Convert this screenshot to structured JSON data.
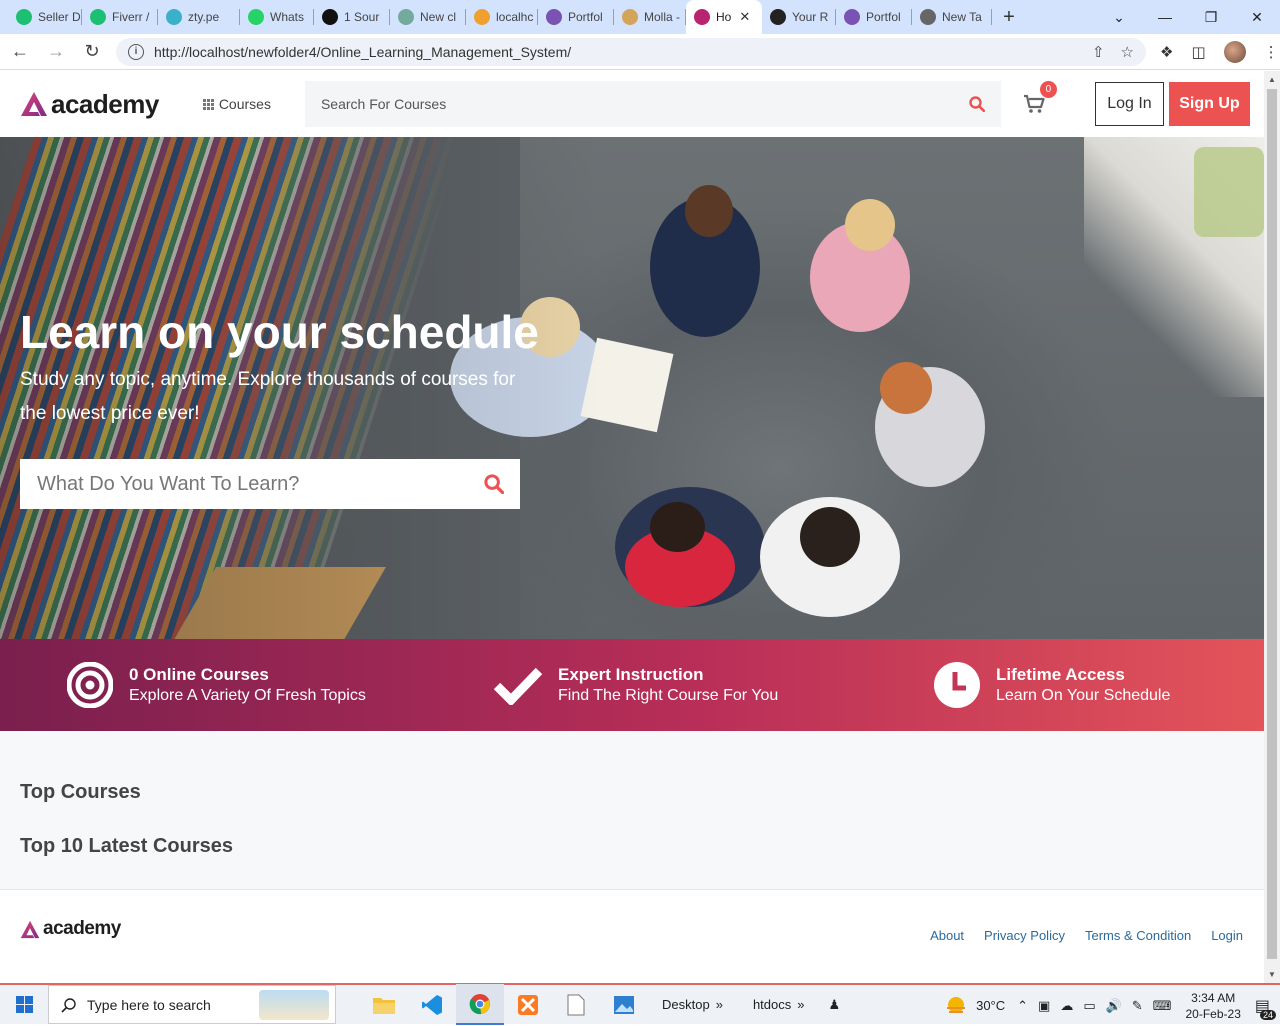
{
  "browser": {
    "tabs": [
      {
        "title": "Seller D",
        "icon": "fiverr-icon",
        "color": "#1dbf73"
      },
      {
        "title": "Fiverr /",
        "icon": "fiverr-icon",
        "color": "#1dbf73"
      },
      {
        "title": "zty.pe",
        "icon": "ztype-icon",
        "color": "#3bb0c9"
      },
      {
        "title": "Whats",
        "icon": "whatsapp-icon",
        "color": "#25d366"
      },
      {
        "title": "1 Sour",
        "icon": "eye-icon",
        "color": "#111111"
      },
      {
        "title": "New cl",
        "icon": "chatgpt-icon",
        "color": "#74aa9c"
      },
      {
        "title": "localhc",
        "icon": "phpmyadmin-icon",
        "color": "#f0a030"
      },
      {
        "title": "Portfol",
        "icon": "bootstrap-icon",
        "color": "#7952b3"
      },
      {
        "title": "Molla -",
        "icon": "molla-icon",
        "color": "#d4a45a"
      },
      {
        "title": "Ho",
        "icon": "academy-icon",
        "color": "#b8246f",
        "active": true
      },
      {
        "title": "Your R",
        "icon": "github-icon",
        "color": "#222222"
      },
      {
        "title": "Portfol",
        "icon": "bootstrap-icon",
        "color": "#7952b3"
      },
      {
        "title": "New Ta",
        "icon": "chrome-icon",
        "color": "#666666"
      }
    ],
    "url": "http://localhost/newfolder4/Online_Learning_Management_System/"
  },
  "header": {
    "logo_text": "academy",
    "courses_label": "Courses",
    "search_placeholder": "Search For Courses",
    "cart_count": "0",
    "login_label": "Log In",
    "signup_label": "Sign Up"
  },
  "hero": {
    "title": "Learn on your schedule",
    "subtitle": "Study any topic, anytime. Explore thousands of courses for the lowest price ever!",
    "search_placeholder": "What Do You Want To Learn?"
  },
  "features": [
    {
      "title": "0 Online Courses",
      "subtitle": "Explore A Variety Of Fresh Topics",
      "icon": "target-icon"
    },
    {
      "title": "Expert Instruction",
      "subtitle": "Find The Right Course For You",
      "icon": "check-icon"
    },
    {
      "title": "Lifetime Access",
      "subtitle": "Learn On Your Schedule",
      "icon": "clock-icon"
    }
  ],
  "content": {
    "top_courses": "Top Courses",
    "latest_courses": "Top 10 Latest Courses"
  },
  "footer": {
    "logo_text": "academy",
    "links": [
      "About",
      "Privacy Policy",
      "Terms & Condition",
      "Login"
    ]
  },
  "taskbar": {
    "search_placeholder": "Type here to search",
    "desktop_label": "Desktop",
    "htdocs_label": "htdocs",
    "temperature": "30°C",
    "time": "3:34 AM",
    "date": "20-Feb-23",
    "notifications": "24"
  },
  "colors": {
    "accent": "#ec5252",
    "brand_gradient_start": "#7a1f4e",
    "brand_gradient_end": "#e35459",
    "link": "#2a6a9e"
  }
}
